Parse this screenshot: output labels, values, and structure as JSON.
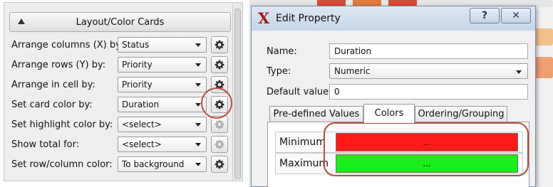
{
  "left_panel": {
    "section_title": "Layout/Color Cards",
    "rows": [
      {
        "label": "Arrange columns (X) by:",
        "value": "Status"
      },
      {
        "label": "Arrange rows (Y) by:",
        "value": "Priority"
      },
      {
        "label": "Arrange in cell by:",
        "value": "Priority"
      },
      {
        "label": "Set card color by:",
        "value": "Duration"
      },
      {
        "label": "Set highlight color by:",
        "value": "<select>"
      },
      {
        "label": "Show total for:",
        "value": "<select>"
      },
      {
        "label": "Set row/column color:",
        "value": "To background"
      }
    ]
  },
  "dialog": {
    "logo": "X",
    "title": "Edit Property",
    "help_label": "?",
    "close_label": "✕",
    "name_label": "Name:",
    "name_value": "Duration",
    "type_label": "Type:",
    "type_value": "Numeric",
    "default_label": "Default value:",
    "default_value": "0",
    "tabs": [
      "Pre-defined Values",
      "Colors",
      "Ordering/Grouping"
    ],
    "active_tab": "Colors",
    "colors": {
      "minimum_label": "Minimum",
      "minimum_button": "...",
      "minimum_color": "#ff1a1a",
      "maximum_label": "Maximum",
      "maximum_button": "...",
      "maximum_color": "#1aee1a"
    }
  }
}
